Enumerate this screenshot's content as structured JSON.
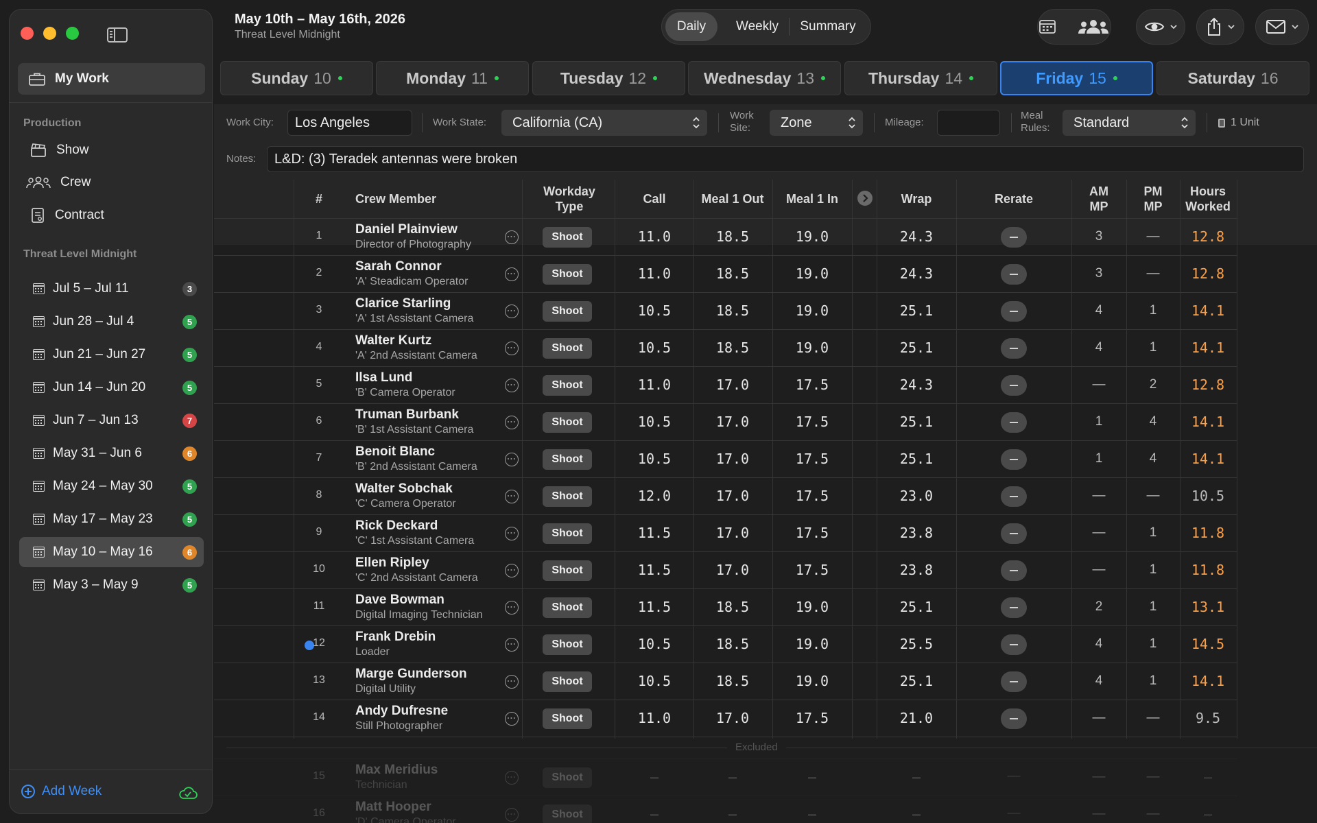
{
  "sidebar": {
    "my_work": "My Work",
    "production_label": "Production",
    "production_items": [
      {
        "label": "Show",
        "icon": "clapperboard-icon"
      },
      {
        "label": "Crew",
        "icon": "people-icon"
      },
      {
        "label": "Contract",
        "icon": "document-icon"
      }
    ],
    "show_label": "Threat Level Midnight",
    "weeks": [
      {
        "label": "Jul 5 – Jul 11",
        "count": "3",
        "color": "#4a4a4b"
      },
      {
        "label": "Jun 28 – Jul 4",
        "count": "5",
        "color": "#30a14e"
      },
      {
        "label": "Jun 21 – Jun 27",
        "count": "5",
        "color": "#30a14e"
      },
      {
        "label": "Jun 14 – Jun 20",
        "count": "5",
        "color": "#30a14e"
      },
      {
        "label": "Jun 7 – Jun 13",
        "count": "7",
        "color": "#d64545"
      },
      {
        "label": "May 31 – Jun 6",
        "count": "6",
        "color": "#e0862a"
      },
      {
        "label": "May 24 – May 30",
        "count": "5",
        "color": "#30a14e"
      },
      {
        "label": "May 17 – May 23",
        "count": "5",
        "color": "#30a14e"
      },
      {
        "label": "May 10 – May 16",
        "count": "6",
        "color": "#e0862a",
        "selected": true
      },
      {
        "label": "May 3 – May 9",
        "count": "5",
        "color": "#30a14e"
      }
    ],
    "add_week": "Add Week"
  },
  "header": {
    "title": "May 10th – May 16th, 2026",
    "subtitle": "Threat Level Midnight",
    "view_tabs": [
      "Daily",
      "Weekly",
      "Summary"
    ],
    "active_view": "Daily"
  },
  "days": [
    {
      "name": "Sunday",
      "num": "10"
    },
    {
      "name": "Monday",
      "num": "11"
    },
    {
      "name": "Tuesday",
      "num": "12"
    },
    {
      "name": "Wednesday",
      "num": "13"
    },
    {
      "name": "Thursday",
      "num": "14"
    },
    {
      "name": "Friday",
      "num": "15",
      "active": true
    },
    {
      "name": "Saturday",
      "num": "16"
    }
  ],
  "form": {
    "work_city_label": "Work City:",
    "work_city": "Los Angeles",
    "work_state_label": "Work State:",
    "work_state": "California (CA)",
    "work_site_label1": "Work",
    "work_site_label2": "Site:",
    "work_site": "Zone",
    "mileage_label": "Mileage:",
    "mileage": "",
    "meal_rules_label1": "Meal",
    "meal_rules_label2": "Rules:",
    "meal_rules": "Standard",
    "unit": "1 Unit",
    "notes_label": "Notes:",
    "notes": "L&D: (3) Teradek antennas were broken"
  },
  "columns": {
    "num": "#",
    "crew": "Crew Member",
    "workday1": "Workday",
    "workday2": "Type",
    "call": "Call",
    "meal1out": "Meal 1 Out",
    "meal1in": "Meal 1 In",
    "wrap": "Wrap",
    "rerate": "Rerate",
    "ammp1": "AM",
    "ammp2": "MP",
    "pmmp1": "PM",
    "pmmp2": "MP",
    "hours1": "Hours",
    "hours2": "Worked"
  },
  "crew": [
    {
      "n": "1",
      "name": "Daniel Plainview",
      "role": "Director of Photography",
      "type": "Shoot",
      "call": "11.0",
      "out": "18.5",
      "in": "19.0",
      "wrap": "24.3",
      "am": "3",
      "pm": "—",
      "hours": "12.8",
      "ot": true
    },
    {
      "n": "2",
      "name": "Sarah Connor",
      "role": "'A' Steadicam Operator",
      "type": "Shoot",
      "call": "11.0",
      "out": "18.5",
      "in": "19.0",
      "wrap": "24.3",
      "am": "3",
      "pm": "—",
      "hours": "12.8",
      "ot": true
    },
    {
      "n": "3",
      "name": "Clarice Starling",
      "role": "'A' 1st Assistant Camera",
      "type": "Shoot",
      "call": "10.5",
      "out": "18.5",
      "in": "19.0",
      "wrap": "25.1",
      "am": "4",
      "pm": "1",
      "hours": "14.1",
      "ot": true
    },
    {
      "n": "4",
      "name": "Walter Kurtz",
      "role": "'A' 2nd Assistant Camera",
      "type": "Shoot",
      "call": "10.5",
      "out": "18.5",
      "in": "19.0",
      "wrap": "25.1",
      "am": "4",
      "pm": "1",
      "hours": "14.1",
      "ot": true
    },
    {
      "n": "5",
      "name": "Ilsa Lund",
      "role": "'B' Camera Operator",
      "type": "Shoot",
      "call": "11.0",
      "out": "17.0",
      "in": "17.5",
      "wrap": "24.3",
      "am": "—",
      "pm": "2",
      "hours": "12.8",
      "ot": true
    },
    {
      "n": "6",
      "name": "Truman Burbank",
      "role": "'B' 1st Assistant Camera",
      "type": "Shoot",
      "call": "10.5",
      "out": "17.0",
      "in": "17.5",
      "wrap": "25.1",
      "am": "1",
      "pm": "4",
      "hours": "14.1",
      "ot": true
    },
    {
      "n": "7",
      "name": "Benoit Blanc",
      "role": "'B' 2nd Assistant Camera",
      "type": "Shoot",
      "call": "10.5",
      "out": "17.0",
      "in": "17.5",
      "wrap": "25.1",
      "am": "1",
      "pm": "4",
      "hours": "14.1",
      "ot": true
    },
    {
      "n": "8",
      "name": "Walter Sobchak",
      "role": "'C' Camera Operator",
      "type": "Shoot",
      "call": "12.0",
      "out": "17.0",
      "in": "17.5",
      "wrap": "23.0",
      "am": "—",
      "pm": "—",
      "hours": "10.5",
      "ot": false
    },
    {
      "n": "9",
      "name": "Rick Deckard",
      "role": "'C' 1st Assistant Camera",
      "type": "Shoot",
      "call": "11.5",
      "out": "17.0",
      "in": "17.5",
      "wrap": "23.8",
      "am": "—",
      "pm": "1",
      "hours": "11.8",
      "ot": true
    },
    {
      "n": "10",
      "name": "Ellen Ripley",
      "role": "'C' 2nd Assistant Camera",
      "type": "Shoot",
      "call": "11.5",
      "out": "17.0",
      "in": "17.5",
      "wrap": "23.8",
      "am": "—",
      "pm": "1",
      "hours": "11.8",
      "ot": true
    },
    {
      "n": "11",
      "name": "Dave Bowman",
      "role": "Digital Imaging Technician",
      "type": "Shoot",
      "call": "11.5",
      "out": "18.5",
      "in": "19.0",
      "wrap": "25.1",
      "am": "2",
      "pm": "1",
      "hours": "13.1",
      "ot": true
    },
    {
      "n": "12",
      "name": "Frank Drebin",
      "role": "Loader",
      "type": "Shoot",
      "call": "10.5",
      "out": "18.5",
      "in": "19.0",
      "wrap": "25.5",
      "am": "4",
      "pm": "1",
      "hours": "14.5",
      "ot": true,
      "flag": true
    },
    {
      "n": "13",
      "name": "Marge Gunderson",
      "role": "Digital Utility",
      "type": "Shoot",
      "call": "10.5",
      "out": "18.5",
      "in": "19.0",
      "wrap": "25.1",
      "am": "4",
      "pm": "1",
      "hours": "14.1",
      "ot": true
    },
    {
      "n": "14",
      "name": "Andy Dufresne",
      "role": "Still Photographer",
      "type": "Shoot",
      "call": "11.0",
      "out": "17.0",
      "in": "17.5",
      "wrap": "21.0",
      "am": "—",
      "pm": "—",
      "hours": "9.5",
      "ot": false
    }
  ],
  "excluded_label": "Excluded",
  "excluded": [
    {
      "n": "15",
      "name": "Max Meridius",
      "role": "Technician",
      "type": "Shoot",
      "call": "—",
      "out": "—",
      "in": "—",
      "wrap": "—",
      "am": "—",
      "pm": "—",
      "hours": "—"
    },
    {
      "n": "16",
      "name": "Matt Hooper",
      "role": "'D' Camera Operator",
      "type": "Shoot",
      "call": "—",
      "out": "—",
      "in": "—",
      "wrap": "—",
      "am": "—",
      "pm": "—",
      "hours": "—"
    }
  ]
}
